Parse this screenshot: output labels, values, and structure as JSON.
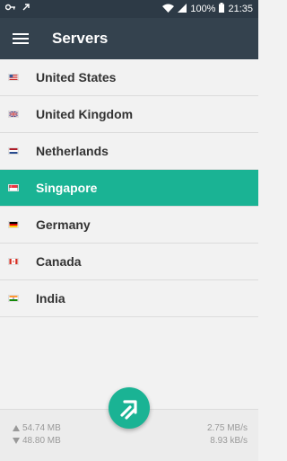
{
  "status_bar": {
    "battery": "100%",
    "time": "21:35",
    "left_icons": [
      "vpn-key-icon",
      "notification-icon"
    ],
    "right_icons": [
      "wifi-icon",
      "signal-icon",
      "battery-icon"
    ]
  },
  "app_bar": {
    "title": "Servers",
    "menu_icon": "hamburger-menu-icon"
  },
  "servers": [
    {
      "label": "United States",
      "flag": "us-flag-icon",
      "selected": false
    },
    {
      "label": "United Kingdom",
      "flag": "uk-flag-icon",
      "selected": false
    },
    {
      "label": "Netherlands",
      "flag": "nl-flag-icon",
      "selected": false
    },
    {
      "label": "Singapore",
      "flag": "sg-flag-icon",
      "selected": true
    },
    {
      "label": "Germany",
      "flag": "de-flag-icon",
      "selected": false
    },
    {
      "label": "Canada",
      "flag": "ca-flag-icon",
      "selected": false
    },
    {
      "label": "India",
      "flag": "in-flag-icon",
      "selected": false
    }
  ],
  "stats": {
    "upload_total": "54.74 MB",
    "download_total": "48.80 MB",
    "upload_speed": "2.75 MB/s",
    "download_speed": "8.93 kB/s"
  },
  "fab_icon": "connect-arrow-icon",
  "colors": {
    "accent": "#1ab394",
    "app_bar": "#34424e",
    "status_bar": "#2d3a46"
  }
}
